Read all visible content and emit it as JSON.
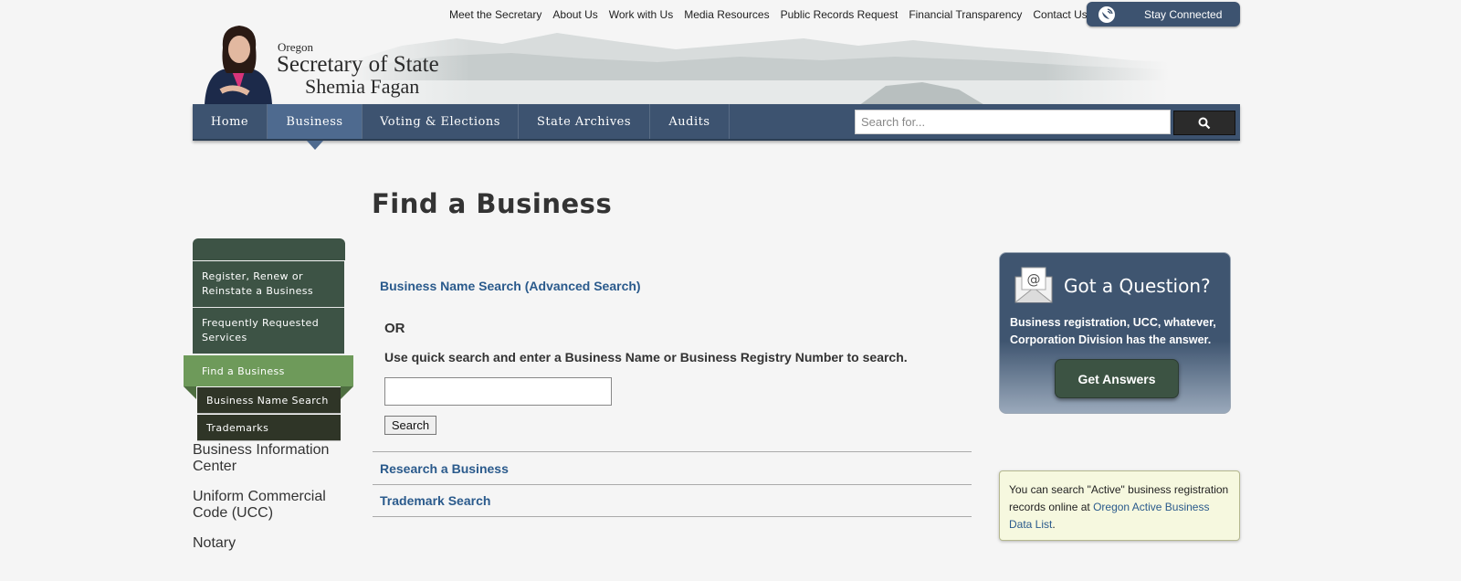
{
  "utility_nav": [
    "Meet the Secretary",
    "About Us",
    "Work with Us",
    "Media Resources",
    "Public Records Request",
    "Financial Transparency",
    "Contact Us"
  ],
  "stay_connected": "Stay Connected",
  "logo": {
    "line1": "Oregon",
    "line2": "Secretary of State",
    "line3": "Shemia Fagan"
  },
  "main_nav": [
    {
      "label": "Home",
      "active": false
    },
    {
      "label": "Business",
      "active": true
    },
    {
      "label": "Voting & Elections",
      "active": false
    },
    {
      "label": "State Archives",
      "active": false
    },
    {
      "label": "Audits",
      "active": false
    }
  ],
  "search": {
    "placeholder": "Search for...",
    "value": ""
  },
  "page_title": "Find a Business",
  "sidebar": {
    "items_before": [
      "Register, Renew or Reinstate a Business",
      "Frequently Requested Services"
    ],
    "active": "Find a Business",
    "sub_items": [
      "Business Name Search",
      "Trademarks"
    ],
    "items_after": [
      "Business Information Center",
      "Uniform Commercial Code (UCC)",
      "Notary"
    ]
  },
  "content": {
    "advanced_link": "Business Name Search (Advanced Search)",
    "or_text": "OR",
    "quick_text": "Use quick search and enter a Business Name or Business Registry Number to search.",
    "quick_value": "",
    "search_button": "Search",
    "research_link": "Research a Business",
    "trademark_link": "Trademark Search"
  },
  "question_box": {
    "title": "Got a Question?",
    "description": "Business registration, UCC, whatever, Corporation Division has the answer.",
    "button": "Get Answers"
  },
  "note_box": {
    "text_before": "You can search \"Active\" business registration records online at ",
    "link": "Oregon Active Business Data List",
    "text_after": "."
  },
  "colors": {
    "nav_blue": "#3d5370",
    "side_green": "#3d5345",
    "active_green": "#6e9a5a",
    "link_blue": "#2a5a8c"
  }
}
